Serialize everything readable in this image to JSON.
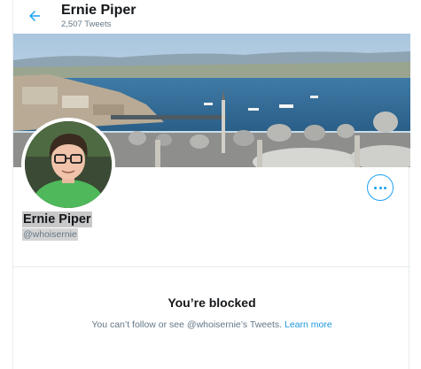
{
  "header": {
    "title": "Ernie Piper",
    "tweet_count": "2,507 Tweets"
  },
  "profile": {
    "display_name": "Ernie Piper",
    "handle": "@whoisernie"
  },
  "blocked": {
    "title": "You’re blocked",
    "message": "You can’t follow or see @whoisernie’s Tweets.",
    "link_label": "Learn more"
  },
  "colors": {
    "accent": "#1da1f2",
    "link": "#1b95e0",
    "secondary_text": "#657786",
    "primary_text": "#14171a"
  },
  "icons": {
    "back": "arrow-left-icon",
    "more": "more-horizontal-icon"
  }
}
